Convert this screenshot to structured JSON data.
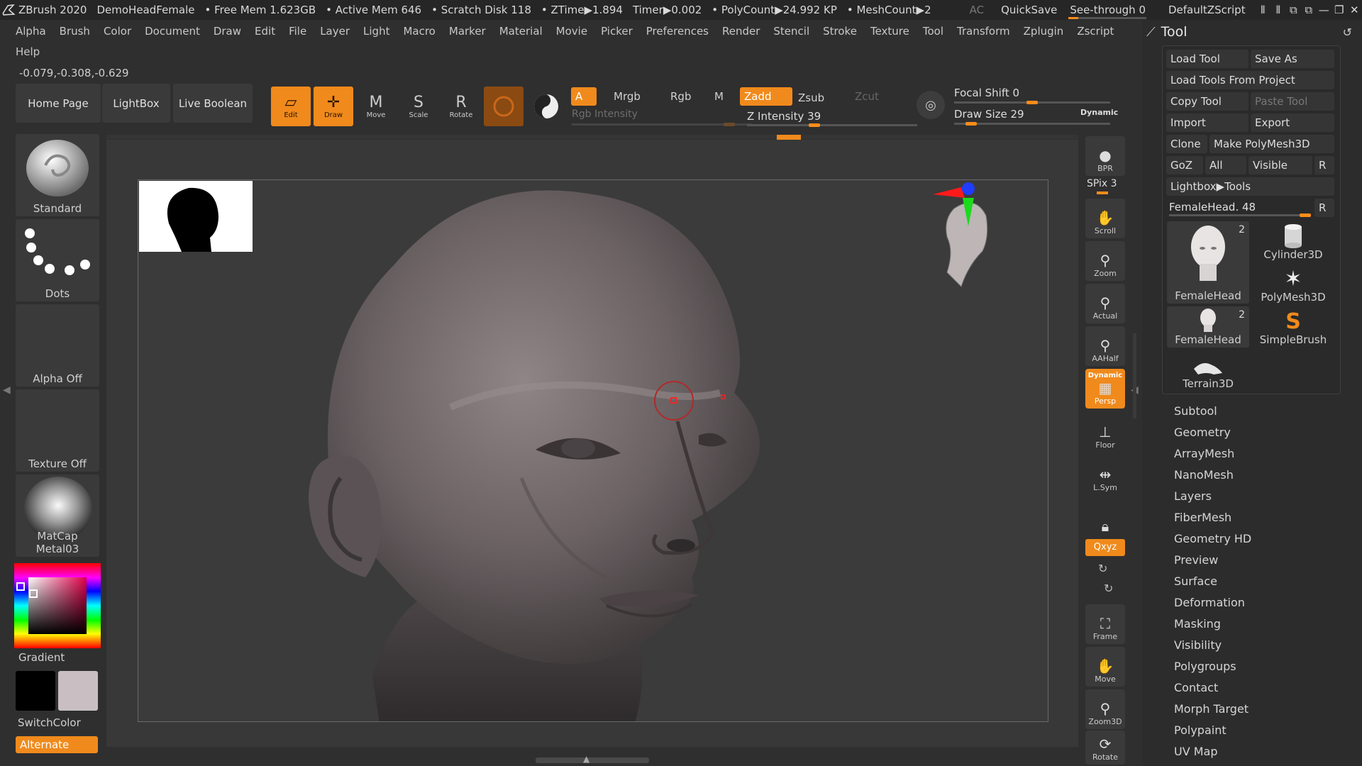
{
  "titlebar": {
    "app": "ZBrush 2020",
    "doc": "DemoHeadFemale",
    "free_mem": "• Free Mem 1.623GB",
    "active_mem": "• Active Mem 646",
    "scratch": "• Scratch Disk 118",
    "ztime": "• ZTime▶1.894",
    "timer": "Timer▶0.002",
    "polycount": "• PolyCount▶24.992 KP",
    "meshcount": "• MeshCount▶2",
    "ac": "AC",
    "quicksave": "QuickSave",
    "seethrough": "See-through",
    "seethrough_value": "0",
    "defaultzscript": "DefaultZScript"
  },
  "menu": [
    "Alpha",
    "Brush",
    "Color",
    "Document",
    "Draw",
    "Edit",
    "File",
    "Layer",
    "Light",
    "Macro",
    "Marker",
    "Material",
    "Movie",
    "Picker",
    "Preferences",
    "Render",
    "Stencil",
    "Stroke",
    "Texture",
    "Tool",
    "Transform",
    "Zplugin",
    "Zscript"
  ],
  "help": "Help",
  "coords": "-0.079,-0.308,-0.629",
  "shelf": {
    "home": "Home Page",
    "lightbox": "LightBox",
    "liveboolean": "Live Boolean",
    "edit": "Edit",
    "draw": "Draw",
    "move": "Move",
    "scale": "Scale",
    "rotate": "Rotate",
    "a": "A",
    "mrgb": "Mrgb",
    "rgb": "Rgb",
    "m": "M",
    "zadd": "Zadd",
    "zsub": "Zsub",
    "zcut": "Zcut",
    "rgb_intensity": "Rgb Intensity",
    "z_intensity": "Z Intensity 39",
    "focal_shift": "Focal Shift 0",
    "draw_size": "Draw Size 29",
    "dynamic": "Dynamic",
    "z_intensity_level": 0.39,
    "draw_size_level": 0.08,
    "focal_shift_level": 0.5
  },
  "left": {
    "brush": "Standard",
    "stroke": "Dots",
    "alpha": "Alpha Off",
    "texture": "Texture Off",
    "material": "MatCap Metal03",
    "gradient": "Gradient",
    "switchcolor": "SwitchColor",
    "alternate": "Alternate",
    "colors": {
      "primary": "#000000",
      "secondary": "#c9bfc2",
      "accent": "#f08a1c"
    }
  },
  "vstrip": {
    "bpr": "BPR",
    "spix": "SPix 3",
    "scroll": "Scroll",
    "zoom": "Zoom",
    "actual": "Actual",
    "aahalf": "AAHalf",
    "dynamic": "Dynamic",
    "persp": "Persp",
    "floor": "Floor",
    "lsym": "L.Sym",
    "xyz": "Qxyz",
    "frame": "Frame",
    "move": "Move",
    "zoom3d": "Zoom3D",
    "rotate": "Rotate"
  },
  "toolpanel": {
    "title": "Tool",
    "load_tool": "Load Tool",
    "save_as": "Save As",
    "load_from_project": "Load Tools From Project",
    "copy_tool": "Copy Tool",
    "paste_tool": "Paste Tool",
    "import": "Import",
    "export": "Export",
    "clone": "Clone",
    "make_polymesh": "Make PolyMesh3D",
    "goz": "GoZ",
    "all": "All",
    "visible": "Visible",
    "r": "R",
    "lightbox_tools": "Lightbox▶Tools",
    "current_tool": "FemaleHead. 48",
    "tools": [
      {
        "name": "FemaleHead",
        "badge": "2"
      },
      {
        "name": "Cylinder3D",
        "badge": ""
      },
      {
        "name": "PolyMesh3D",
        "badge": ""
      },
      {
        "name": "FemaleHead",
        "badge": "2"
      },
      {
        "name": "SimpleBrush",
        "badge": ""
      },
      {
        "name": "Terrain3D",
        "badge": ""
      }
    ],
    "sections": [
      "Subtool",
      "Geometry",
      "ArrayMesh",
      "NanoMesh",
      "Layers",
      "FiberMesh",
      "Geometry HD",
      "Preview",
      "Surface",
      "Deformation",
      "Masking",
      "Visibility",
      "Polygroups",
      "Contact",
      "Morph Target",
      "Polypaint",
      "UV Map"
    ]
  }
}
